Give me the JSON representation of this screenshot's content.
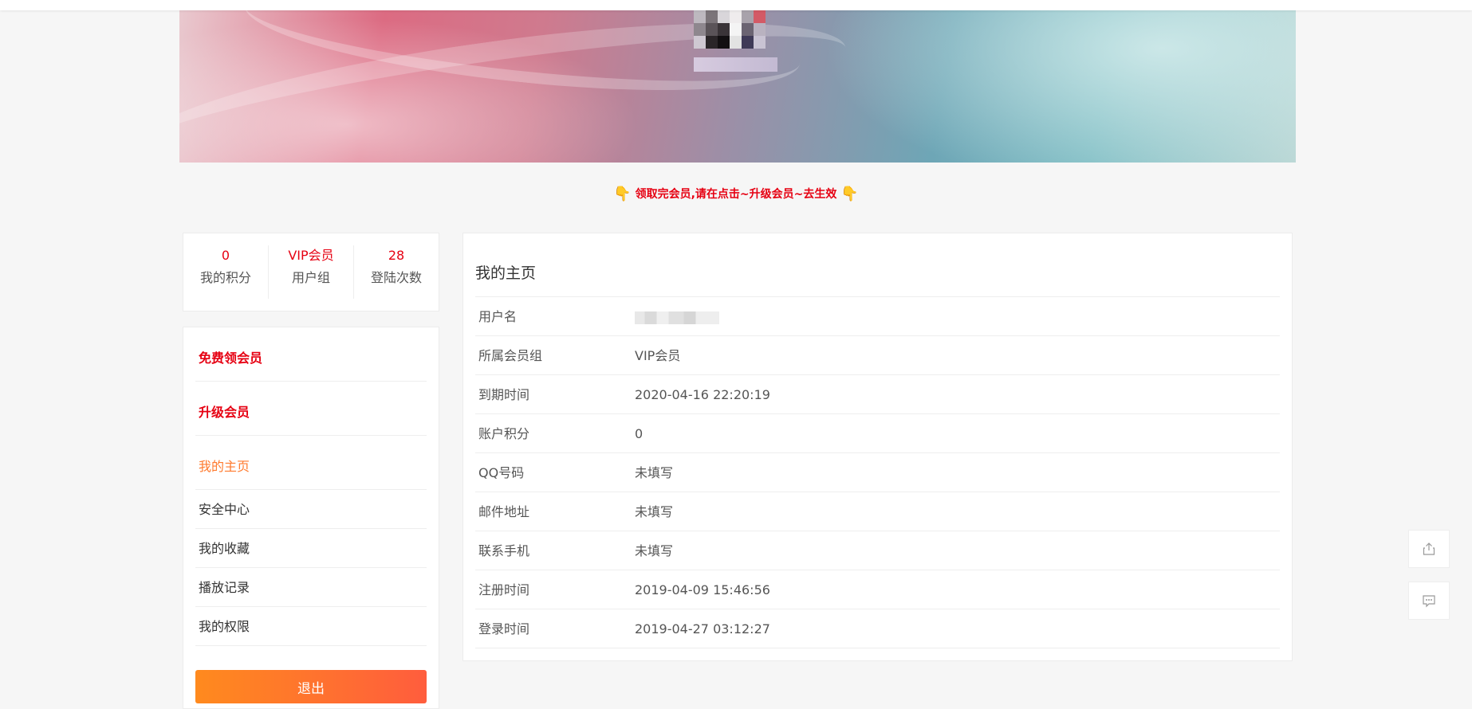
{
  "notice": {
    "text": "领取完会员,请在点击~升级会员~去生效",
    "hand_left": "👇",
    "hand_right": "👇"
  },
  "stats": [
    {
      "value": "0",
      "label": "我的积分"
    },
    {
      "value": "VIP会员",
      "label": "用户组"
    },
    {
      "value": "28",
      "label": "登陆次数"
    }
  ],
  "menu": {
    "free_vip": "免费领会员",
    "upgrade": "升级会员",
    "items": [
      "我的主页",
      "安全中心",
      "我的收藏",
      "播放记录",
      "我的权限"
    ],
    "logout": "退出"
  },
  "profile": {
    "title": "我的主页",
    "rows": [
      {
        "key": "用户名",
        "value": ""
      },
      {
        "key": "所属会员组",
        "value": "VIP会员"
      },
      {
        "key": "到期时间",
        "value": "2020-04-16 22:20:19"
      },
      {
        "key": "账户积分",
        "value": "0"
      },
      {
        "key": "QQ号码",
        "value": "未填写"
      },
      {
        "key": "邮件地址",
        "value": "未填写"
      },
      {
        "key": "联系手机",
        "value": "未填写"
      },
      {
        "key": "注册时间",
        "value": "2019-04-09 15:46:56"
      },
      {
        "key": "登录时间",
        "value": "2019-04-27 03:12:27"
      }
    ]
  },
  "icons": {
    "share": "share-icon",
    "comment": "comment-icon"
  },
  "colors": {
    "accent_red": "#e60012",
    "active_orange": "#ff7a2e",
    "button_gradient_start": "#ff8a1e",
    "button_gradient_end": "#ff5d3d"
  }
}
